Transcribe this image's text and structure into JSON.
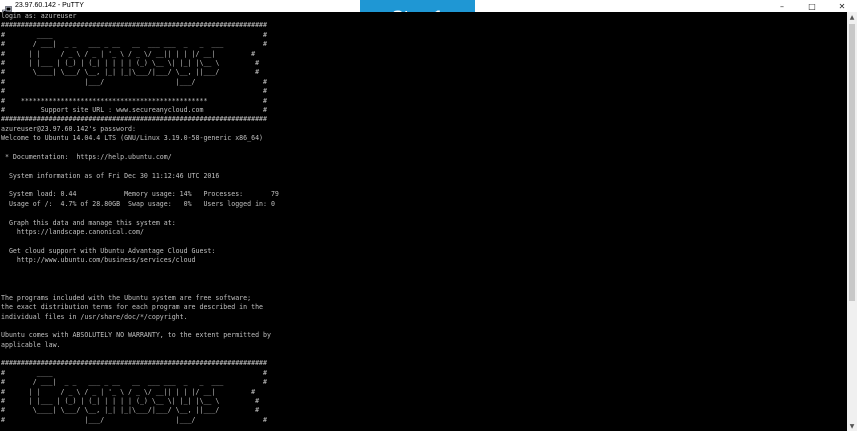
{
  "window": {
    "title": "23.97.60.142 - PuTTY",
    "minimize_glyph": "–",
    "maximize_glyph": "□",
    "close_glyph": "✕"
  },
  "overlay": {
    "step_label": "Step 1"
  },
  "colors": {
    "terminal_bg": "#000000",
    "terminal_fg": "#c0c0c0",
    "badge": "#1f97d4"
  },
  "terminal": {
    "lines": [
      "login as: azureuser",
      "###################################################################",
      "#        ____                                                     #",
      "#       / ___|  _ _   ___ _ __   __  ___ ___  _   _  ___          #",
      "#      | |     / _ \\ / _ | '_ \\ / _ \\/ __|| | | |/ __|         #",
      "#      | |___ | (_) | (_| | | | | (_) \\__ \\| |_| |\\__ \\         #",
      "#       \\____| \\___/ \\__, |_| |_|\\___/|___/ \\__, ||___/         #",
      "#                    |___/                  |___/                 #",
      "#                                                                 #",
      "#    ***********************************************              #",
      "#         Support site URL : www.secureanycloud.com               #",
      "###################################################################",
      "azureuser@23.97.60.142's password:",
      "Welcome to Ubuntu 14.04.4 LTS (GNU/Linux 3.19.0-58-generic x86_64)",
      "",
      " * Documentation:  https://help.ubuntu.com/",
      "",
      "  System information as of Fri Dec 30 11:12:46 UTC 2016",
      "",
      "  System load: 0.44            Memory usage: 14%   Processes:       79",
      "  Usage of /:  4.7% of 28.80GB  Swap usage:   0%   Users logged in: 0",
      "",
      "  Graph this data and manage this system at:",
      "    https://landscape.canonical.com/",
      "",
      "  Get cloud support with Ubuntu Advantage Cloud Guest:",
      "    http://www.ubuntu.com/business/services/cloud",
      "",
      "",
      "",
      "The programs included with the Ubuntu system are free software;",
      "the exact distribution terms for each program are described in the",
      "individual files in /usr/share/doc/*/copyright.",
      "",
      "Ubuntu comes with ABSOLUTELY NO WARRANTY, to the extent permitted by",
      "applicable law.",
      "",
      "###################################################################",
      "#        ____                                                     #",
      "#       / ___|  _ _   ___ _ __   __  ___ ___  _   _  ___          #",
      "#      | |     / _ \\ / _ | '_ \\ / _ \\/ __|| | | |/ __|         #",
      "#      | |___ | (_) | (_| | | | | (_) \\__ \\| |_| |\\__ \\         #",
      "#       \\____| \\___/ \\__, |_| |_|\\___/|___/ \\__, ||___/         #",
      "#                    |___/                  |___/                 #"
    ]
  },
  "scrollbar": {
    "up_glyph": "▲",
    "down_glyph": "▼"
  }
}
